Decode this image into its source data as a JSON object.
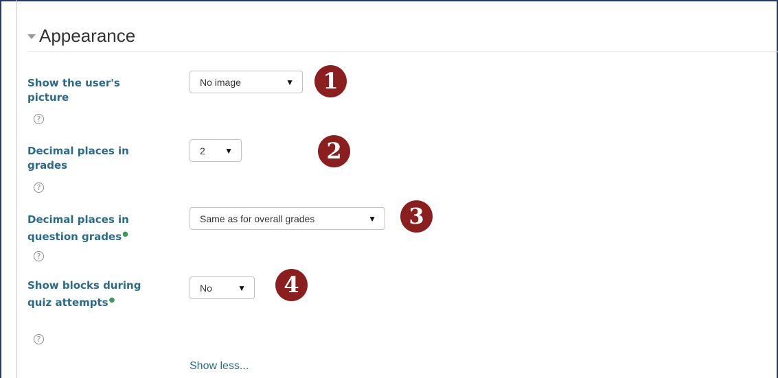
{
  "section": {
    "title": "Appearance"
  },
  "settings": [
    {
      "label": "Show the user's picture",
      "required": false,
      "select_value": "No image",
      "marker": "1"
    },
    {
      "label": "Decimal places in grades",
      "required": false,
      "select_value": "2",
      "marker": "2"
    },
    {
      "label": "Decimal places in question grades",
      "required": true,
      "select_value": "Same as for overall grades",
      "marker": "3"
    },
    {
      "label": "Show blocks during quiz attempts",
      "required": true,
      "select_value": "No",
      "marker": "4"
    }
  ],
  "help_icon_glyph": "?",
  "dropdown_caret": "▼",
  "show_less_link": "Show less...",
  "colors": {
    "label": "#2a6b8c",
    "badge": "#8b1f1f",
    "required_marker": "#3c9b5c",
    "frame": "#1f3d6b"
  }
}
